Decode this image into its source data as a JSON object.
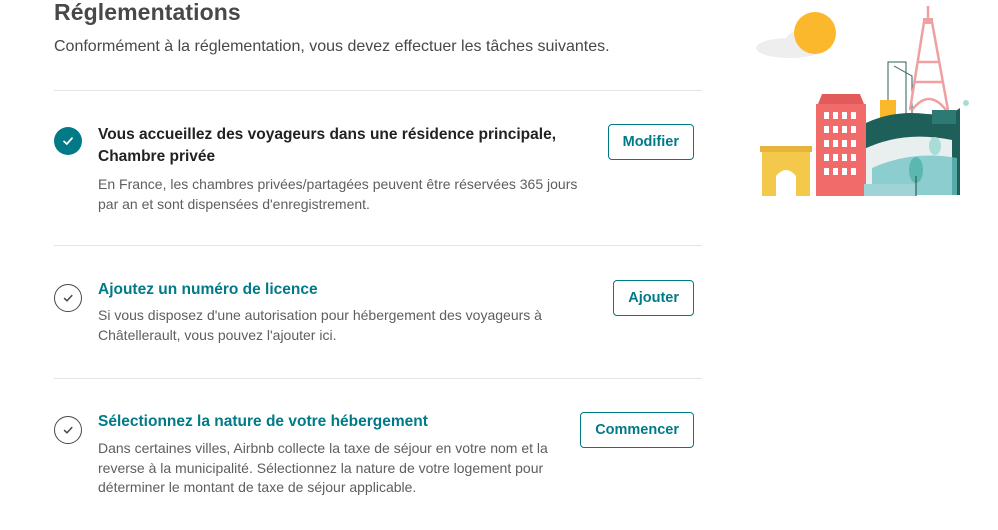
{
  "header": {
    "title": "Réglementations",
    "subtitle": "Conformément à la réglementation, vous devez effectuer les tâches suivantes."
  },
  "tasks": [
    {
      "status": "complete",
      "title": "Vous accueillez des voyageurs dans une résidence principale, Chambre privée",
      "description": "En France, les chambres privées/partagées peuvent être réservées 365 jours par an et sont dispensées d'enregistrement.",
      "button_label": "Modifier"
    },
    {
      "status": "pending",
      "title": "Ajoutez un numéro de licence",
      "description": "Si vous disposez d'une autorisation pour hébergement des voyageurs à Châtellerault, vous pouvez l'ajouter ici.",
      "button_label": "Ajouter"
    },
    {
      "status": "pending",
      "title": "Sélectionnez la nature de votre hébergement",
      "description": "Dans certaines villes, Airbnb collecte la taxe de séjour en votre nom et la reverse à la municipalité. Sélectionnez la nature de votre logement pour déterminer le montant de taxe de séjour applicable.",
      "button_label": "Commencer"
    }
  ],
  "icons": {
    "complete": "check-circle-filled-icon",
    "pending": "check-circle-outline-icon",
    "illustration": "paris-city-illustration"
  },
  "colors": {
    "accent": "#007a87",
    "text": "#222222",
    "muted": "#5e5e5e",
    "divider": "#e4e4e4"
  }
}
